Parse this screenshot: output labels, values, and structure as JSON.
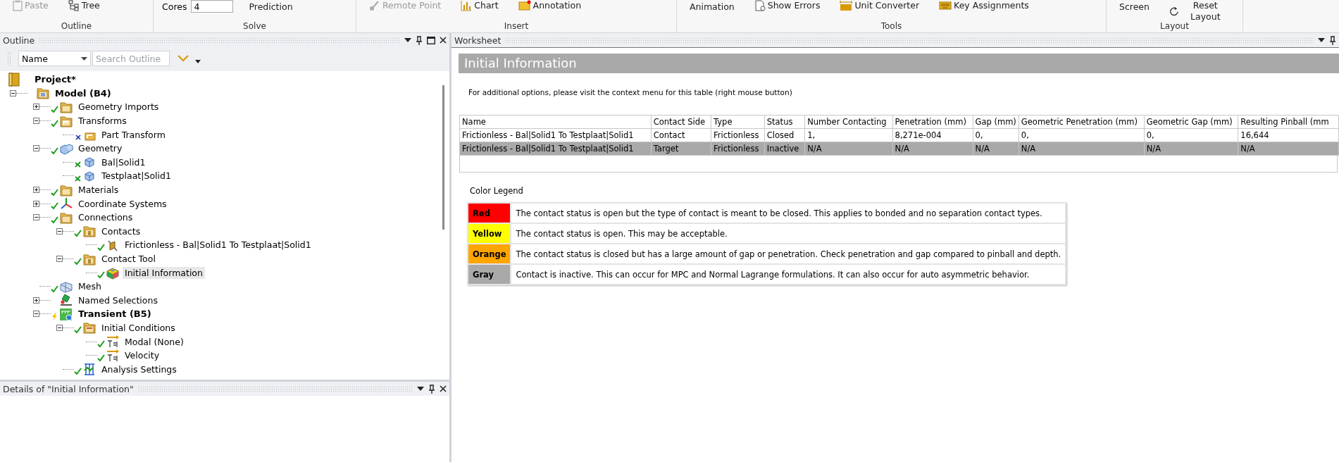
{
  "ribbon": {
    "groups": [
      {
        "label": "Outline",
        "items": [
          {
            "kind": "small",
            "label": "Paste",
            "disabled": true
          },
          {
            "kind": "small",
            "label": "Tree",
            "disabled": false
          }
        ]
      },
      {
        "label": "Solve",
        "items": [
          {
            "kind": "field",
            "label": "Cores",
            "value": "4"
          },
          {
            "kind": "large",
            "label": "Prediction",
            "disabled": false
          }
        ]
      },
      {
        "label": "Insert",
        "items": [
          {
            "kind": "small",
            "label": "Remote Point",
            "disabled": true
          },
          {
            "kind": "small",
            "label": "Chart",
            "disabled": false
          },
          {
            "kind": "small",
            "label": "Annotation",
            "disabled": false
          }
        ]
      },
      {
        "label": "Tools",
        "items": [
          {
            "kind": "large",
            "label": "Animation",
            "disabled": false
          },
          {
            "kind": "small",
            "label": "Show Errors",
            "disabled": false
          },
          {
            "kind": "small",
            "label": "Unit Converter",
            "disabled": false
          },
          {
            "kind": "small",
            "label": "Key Assignments",
            "disabled": false
          }
        ]
      },
      {
        "label": "Layout",
        "items": [
          {
            "kind": "large",
            "label": "Screen",
            "disabled": false
          },
          {
            "kind": "small",
            "label": "Reset Layout",
            "disabled": false
          }
        ]
      }
    ]
  },
  "outline": {
    "title": "Outline",
    "filter": {
      "value": "Name",
      "placeholder": "Search Outline"
    },
    "tree": [
      {
        "label": "Project*",
        "kind": "project",
        "selected": false,
        "children": [
          {
            "label": "Model (B4)",
            "kind": "model",
            "selected": false,
            "expanded": true,
            "children": [
              {
                "label": "Geometry Imports",
                "kind": "folder",
                "ok": true,
                "selected": false,
                "expanded": false
              },
              {
                "label": "Transforms",
                "kind": "transform",
                "ok": true,
                "selected": false,
                "expanded": true,
                "children": [
                  {
                    "label": "Part Transform",
                    "kind": "part-transform",
                    "ok": false,
                    "selected": false
                  }
                ]
              },
              {
                "label": "Geometry",
                "kind": "geometry",
                "ok": true,
                "selected": false,
                "expanded": true,
                "children": [
                  {
                    "label": "Bal|Solid1",
                    "kind": "solid",
                    "ok": true,
                    "selected": false
                  },
                  {
                    "label": "Testplaat|Solid1",
                    "kind": "solid",
                    "ok": true,
                    "selected": false
                  }
                ]
              },
              {
                "label": "Materials",
                "kind": "folder",
                "ok": true,
                "selected": false,
                "expanded": false
              },
              {
                "label": "Coordinate Systems",
                "kind": "axes",
                "ok": true,
                "selected": false,
                "expanded": false
              },
              {
                "label": "Connections",
                "kind": "folder",
                "ok": true,
                "selected": false,
                "expanded": true,
                "children": [
                  {
                    "label": "Contacts",
                    "kind": "contact-folder",
                    "ok": true,
                    "selected": false,
                    "expanded": true,
                    "children": [
                      {
                        "label": "Frictionless - Bal|Solid1 To Testplaat|Solid1",
                        "kind": "contact",
                        "ok": true,
                        "selected": false
                      }
                    ]
                  },
                  {
                    "label": "Contact Tool",
                    "kind": "contact-folder",
                    "ok": true,
                    "selected": false,
                    "expanded": true,
                    "children": [
                      {
                        "label": "Initial Information",
                        "kind": "result",
                        "ok": true,
                        "selected": true
                      }
                    ]
                  }
                ]
              },
              {
                "label": "Mesh",
                "kind": "mesh",
                "ok": true,
                "selected": false
              },
              {
                "label": "Named Selections",
                "kind": "selection",
                "ok": false,
                "selected": false,
                "expanded": false
              },
              {
                "label": "Transient (B5)",
                "kind": "transient",
                "ok": false,
                "selected": false,
                "expanded": true,
                "children": [
                  {
                    "label": "Initial Conditions",
                    "kind": "conditions",
                    "ok": true,
                    "selected": false,
                    "expanded": true,
                    "children": [
                      {
                        "label": "Modal (None)",
                        "kind": "t0",
                        "ok": true,
                        "selected": false
                      },
                      {
                        "label": "Velocity",
                        "kind": "t0",
                        "ok": true,
                        "selected": false
                      }
                    ]
                  },
                  {
                    "label": "Analysis Settings",
                    "kind": "settings",
                    "ok": true,
                    "selected": false
                  }
                ]
              }
            ]
          }
        ]
      }
    ]
  },
  "details": {
    "title": "Details of \"Initial Information\""
  },
  "worksheet": {
    "title": "Worksheet",
    "heading": "Initial Information",
    "note": "For additional options, please visit the context menu for this table (right mouse button)",
    "table": {
      "columns": [
        "Name",
        "Contact Side",
        "Type",
        "Status",
        "Number Contacting",
        "Penetration (mm)",
        "Gap (mm)",
        "Geometric Penetration (mm)",
        "Geometric Gap (mm)",
        "Resulting Pinball (mm"
      ],
      "rows": [
        {
          "inactive": false,
          "cells": [
            "Frictionless - Bal|Solid1 To Testplaat|Solid1",
            "Contact",
            "Frictionless",
            "Closed",
            "1,",
            "8,271e-004",
            "0,",
            "0,",
            "0,",
            "16,644"
          ]
        },
        {
          "inactive": true,
          "cells": [
            "Frictionless - Bal|Solid1 To Testplaat|Solid1",
            "Target",
            "Frictionless",
            "Inactive",
            "N/A",
            "N/A",
            "N/A",
            "N/A",
            "N/A",
            "N/A"
          ]
        }
      ]
    },
    "legend": {
      "title": "Color Legend",
      "entries": [
        {
          "label": "Red",
          "color": "#ff0000",
          "text": "The contact status is open but the type of contact is meant to be closed. This applies to bonded and no separation contact types."
        },
        {
          "label": "Yellow",
          "color": "#ffff00",
          "text": "The contact status is open. This may be acceptable."
        },
        {
          "label": "Orange",
          "color": "#ffa500",
          "text": "The contact status is closed but has a large amount of gap or penetration. Check penetration and gap compared to pinball and depth."
        },
        {
          "label": "Gray",
          "color": "#a9a9a9",
          "text": "Contact is inactive. This can occur for MPC and Normal Lagrange formulations. It can also occur for auto asymmetric behavior."
        }
      ]
    }
  }
}
